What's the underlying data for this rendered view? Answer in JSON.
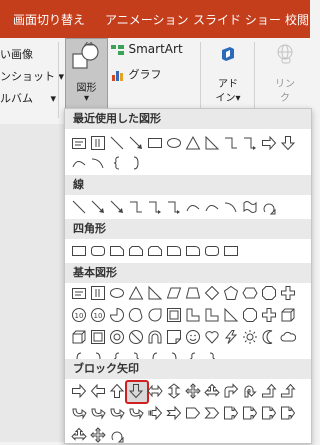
{
  "tabs": [
    {
      "label": "画面切り替え"
    },
    {
      "label": "アニメーション"
    },
    {
      "label": "スライド ショー"
    },
    {
      "label": "校閲"
    }
  ],
  "ribbon": {
    "left_items": [
      "い画像",
      "ンショット",
      "ルバム"
    ],
    "shapes_label": "図形",
    "smartart_label": "SmartArt",
    "graph_label": "グラフ",
    "addin_label": "アド",
    "addin_label2": "イン",
    "link_label": "リン",
    "link_label2": "ク"
  },
  "gallery": {
    "sections": [
      {
        "title": "最近使用した図形"
      },
      {
        "title": "線"
      },
      {
        "title": "四角形"
      },
      {
        "title": "基本図形"
      },
      {
        "title": "ブロック矢印"
      }
    ],
    "selected_shape": "down-arrow"
  },
  "colors": {
    "accent": "#c43e1c",
    "highlight": "#d12020"
  }
}
